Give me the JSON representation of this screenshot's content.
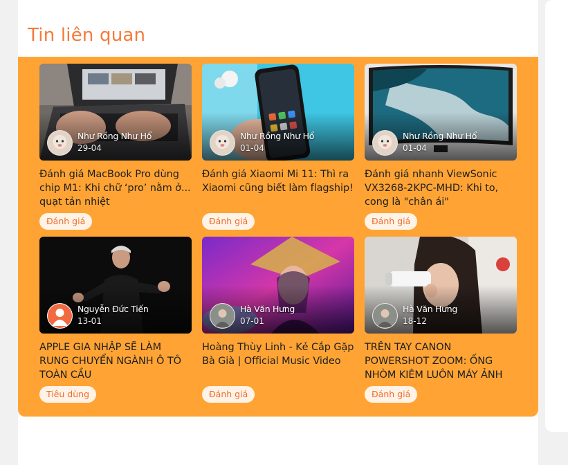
{
  "section": {
    "title": "Tin liên quan"
  },
  "colors": {
    "accent": "#f47a39",
    "panel": "#ffa434",
    "tag_bg": "#fff3e7"
  },
  "articles": [
    {
      "title": "Đánh giá MacBook Pro dùng chip M1: Khi chữ ‘pro’ nằm ở... quạt tản nhiệt",
      "author": "Như Rồng Như Hổ",
      "date": "29-04",
      "tag": "Đánh giá",
      "image": "laptop-typing-photo"
    },
    {
      "title": "Đánh giá Xiaomi Mi 11: Thì ra Xiaomi cũng biết làm flagship!",
      "author": "Như Rồng Như Hổ",
      "date": "01-04",
      "tag": "Đánh giá",
      "image": "phone-in-hand-photo"
    },
    {
      "title": "Đánh giá nhanh ViewSonic VX3268-2KPC-MHD: Khi to, cong là \"chân ái\"",
      "author": "Như Rồng Như Hổ",
      "date": "01-04",
      "tag": "Đánh giá",
      "image": "monitor-photo"
    },
    {
      "title": "APPLE GIA NHẬP SẼ LÀM RUNG CHUYỂN NGÀNH Ô TÔ TOÀN CẦU",
      "author": "Nguyễn Đức Tiến",
      "date": "13-01",
      "tag": "Tiêu dùng",
      "image": "speaker-on-stage-photo"
    },
    {
      "title": "Hoàng Thùy Linh - Kẻ Cắp Gặp Bà Già | Official Music Video",
      "author": "Hà Văn Hưng",
      "date": "07-01",
      "tag": "Đánh giá",
      "image": "music-video-photo"
    },
    {
      "title": "TRÊN TAY CANON POWERSHOT ZOOM: ỐNG NHÒM KIÊM LUÔN MÁY ẢNH",
      "author": "Hà Văn Hưng",
      "date": "18-12",
      "tag": "Đánh giá",
      "image": "camera-photo"
    }
  ]
}
